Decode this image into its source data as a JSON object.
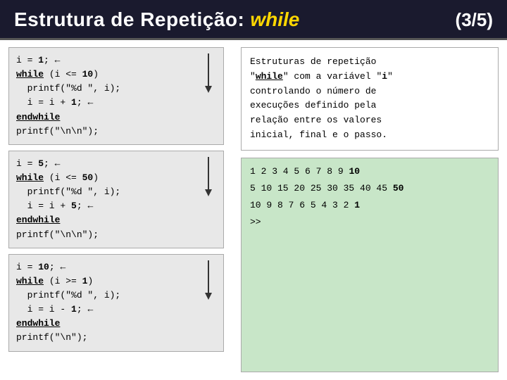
{
  "header": {
    "title": "Estrutura de Repetição: ",
    "keyword": "while",
    "badge": "(3/5)"
  },
  "code_blocks": [
    {
      "id": "block1",
      "lines": [
        "i = 1; ←",
        "while (i <= 10)",
        "  printf(\"%d \", i);",
        "  i = i + 1; ←",
        "endwhile",
        "printf(\"\\n\\n\");"
      ]
    },
    {
      "id": "block2",
      "lines": [
        "i = 5; ←",
        "while (i <= 50)",
        "  printf(\"%d \", i);",
        "  i = i + 5; ←",
        "endwhile",
        "printf(\"\\n\\n\");"
      ]
    },
    {
      "id": "block3",
      "lines": [
        "i = 10; ←",
        "while (i >= 1)",
        "  printf(\"%d \", i);",
        "  i = i - 1; ←",
        "endwhile",
        "printf(\"\\n\");"
      ]
    }
  ],
  "description": {
    "line1": "Estruturas de repetição",
    "line2_pre": "\"",
    "line2_kw": "while",
    "line2_post": "\" com a variável \"i\"",
    "line3": "controlando o número de",
    "line4": "execuções definido pela",
    "line5": "relação entre os valores",
    "line6": "inicial, final e o passo."
  },
  "output": {
    "lines": [
      {
        "text": "1 2 3 4 5 6 7 8 9 ",
        "bold_end": "10"
      },
      {
        "text": "5 10 15 20 25 30 35 40 45 ",
        "bold_end": "50"
      },
      {
        "text": "10 9 8 7 6 5 4 3 2 ",
        "bold_end": "1"
      },
      {
        "text": ">>"
      }
    ]
  }
}
